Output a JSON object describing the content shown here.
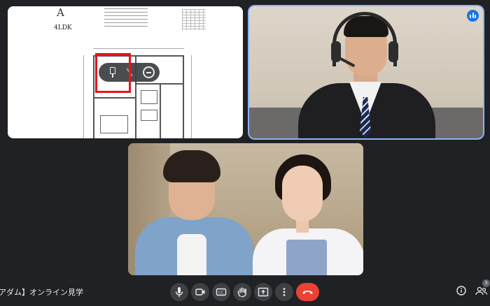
{
  "shared_document": {
    "plan_letter": "A",
    "plan_type": "4LDK",
    "pin_toolbar": {
      "pin_icon": "pin-icon",
      "fullscreen_icon": "fullscreen-icon",
      "remove_icon": "remove-icon"
    },
    "highlight_color": "#e6141b"
  },
  "agent_tile": {
    "speaking_icon": "audio-wave-icon",
    "active_border_color": "#8ab4f8"
  },
  "bottom_bar": {
    "meeting_title": "アダム】オンライン見学",
    "controls": [
      {
        "name": "microphone-button",
        "icon": "mic-icon"
      },
      {
        "name": "camera-button",
        "icon": "camera-icon"
      },
      {
        "name": "captions-button",
        "icon": "captions-icon"
      },
      {
        "name": "raise-hand-button",
        "icon": "hand-icon"
      },
      {
        "name": "present-button",
        "icon": "present-icon"
      },
      {
        "name": "more-options-button",
        "icon": "more-vert-icon"
      },
      {
        "name": "leave-call-button",
        "icon": "phone-hangup-icon"
      }
    ],
    "end_call_color": "#ea4335",
    "info_icon": "info-icon",
    "people_icon": "people-icon",
    "people_count": "3"
  }
}
